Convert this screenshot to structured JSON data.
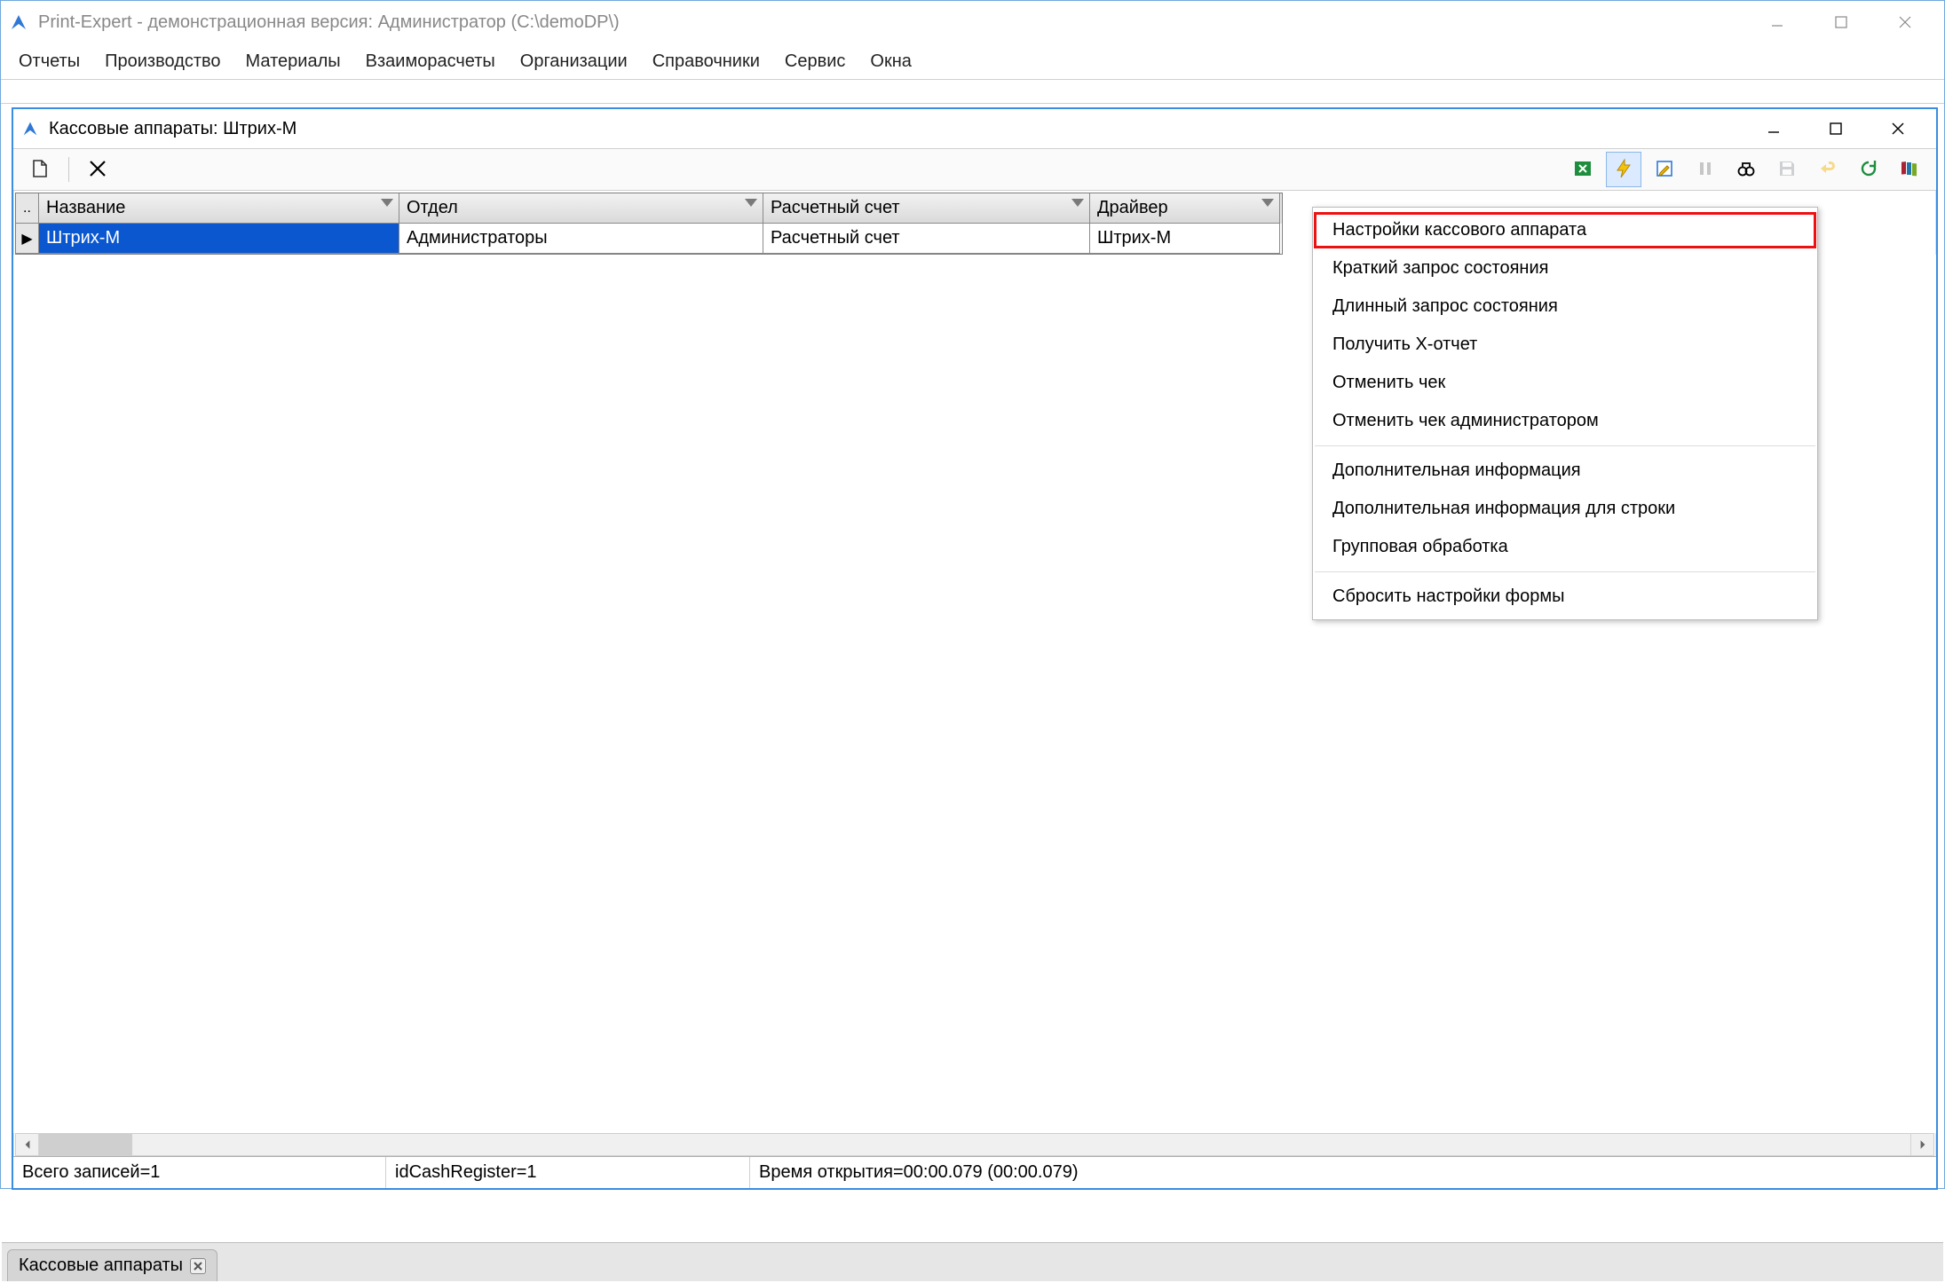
{
  "main_window": {
    "title": "Print-Expert - демонстрационная версия: Администратор (C:\\demoDP\\)",
    "menu": [
      "Отчеты",
      "Производство",
      "Материалы",
      "Взаиморасчеты",
      "Организации",
      "Справочники",
      "Сервис",
      "Окна"
    ]
  },
  "child_window": {
    "title": "Кассовые аппараты: Штрих-М",
    "toolbar_left": {
      "new": "new-document-icon",
      "delete": "delete-icon"
    },
    "toolbar_right": [
      "excel-export-icon",
      "lightning-icon",
      "edit-icon",
      "columns-icon",
      "binoculars-icon",
      "save-icon",
      "undo-icon",
      "refresh-icon",
      "books-icon"
    ],
    "columns": [
      {
        "key": "name",
        "label": "Название"
      },
      {
        "key": "dept",
        "label": "Отдел"
      },
      {
        "key": "acct",
        "label": "Расчетный счет"
      },
      {
        "key": "driver",
        "label": "Драйвер"
      }
    ],
    "rows": [
      {
        "name": "Штрих-М",
        "dept": "Администраторы",
        "acct": "Расчетный счет",
        "driver": "Штрих-М"
      }
    ],
    "status": {
      "records": "Всего записей=1",
      "id": "idCashRegister=1",
      "time": "Время открытия=00:00.079 (00:00.079)"
    }
  },
  "context_menu": {
    "groups": [
      [
        "Настройки кассового аппарата",
        "Краткий запрос состояния",
        "Длинный запрос состояния",
        "Получить X-отчет",
        "Отменить чек",
        "Отменить чек администратором"
      ],
      [
        "Дополнительная информация",
        "Дополнительная информация для строки",
        "Групповая обработка"
      ],
      [
        "Сбросить настройки формы"
      ]
    ],
    "highlight": "Настройки кассового аппарата"
  },
  "doc_tabs": [
    {
      "label": "Кассовые аппараты"
    }
  ]
}
